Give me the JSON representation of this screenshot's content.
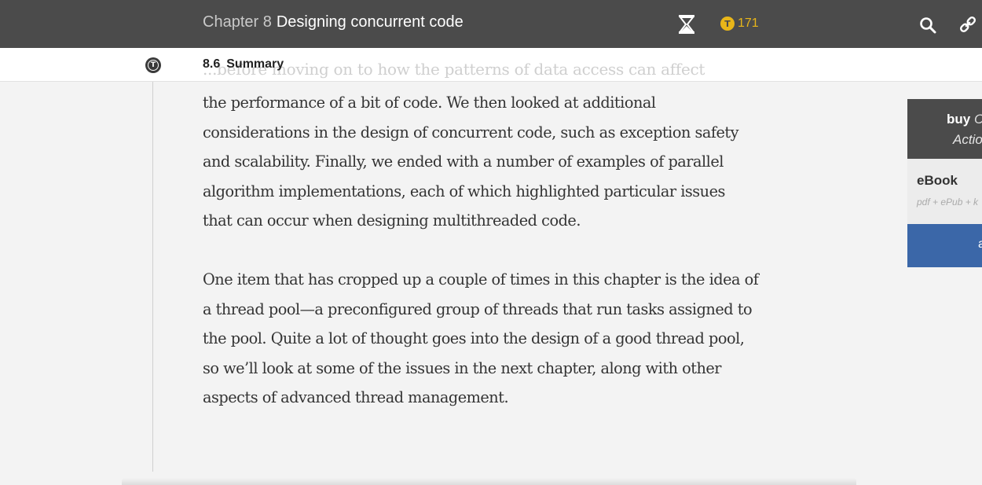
{
  "header": {
    "chapter_prefix": "Chapter 8",
    "chapter_title": "Designing concurrent code",
    "token_symbol": "T",
    "token_count": "171",
    "token_color": "#e8b619",
    "icons": [
      "hourglass-icon",
      "token-icon",
      "search-icon",
      "link-icon"
    ]
  },
  "section": {
    "badge_symbol": "T",
    "number": "8.6",
    "title": "Summary"
  },
  "faded_line": "...before moving on to how the patterns of data access can affect",
  "content": {
    "paragraph1_lines": [
      "the performance of a bit of code. We then looked at additional",
      "considerations in the design of concurrent code, such as exception safety",
      "and scalability. Finally, we ended with a number of examples of parallel",
      "algorithm implementations, each of which highlighted particular issues",
      "that can occur when designing multithreaded code."
    ],
    "paragraph2_lines": [
      "One item that has cropped up a couple of times in this chapter is the idea of",
      "a thread pool—a preconfigured group of threads that run tasks assigned to",
      "the pool. Quite a lot of thought goes into the design of a good thread pool,",
      "so we’ll look at some of the issues in the next chapter, along with other",
      "aspects of advanced thread management."
    ]
  },
  "buy_card": {
    "head_line1_bold": "buy",
    "head_line1_rest": "C",
    "head_line2": "Actio",
    "format": "eBook",
    "format_sub": "pdf + ePub + k",
    "button_label": "a",
    "button_color": "#3b67a8"
  }
}
